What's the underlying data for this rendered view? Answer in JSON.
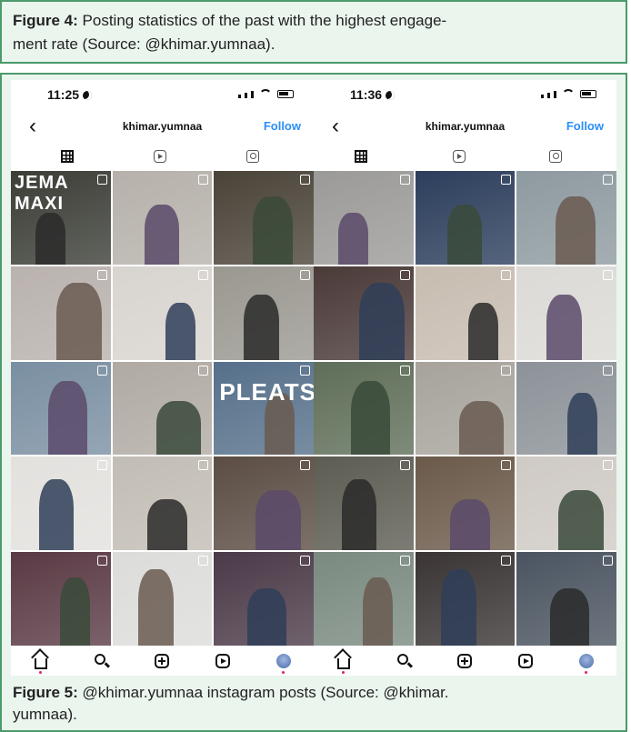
{
  "figure4": {
    "label": "Figure 4:",
    "line1": " Posting statistics of the past with the highest engage-",
    "line2": "ment rate (Source: @khimar.yumnaa)."
  },
  "figure5": {
    "label": "Figure 5:",
    "line1": " @khimar.yumnaa instagram posts (Source: @khimar.",
    "line2": "yumnaa)."
  },
  "phones": [
    {
      "time": "11:25",
      "username": "khimar.yumnaa",
      "follow_label": "Follow",
      "tiles": [
        {
          "bg": "#3b3d36",
          "label": "JEMA MAXI"
        },
        {
          "bg": "#b6b1aa"
        },
        {
          "bg": "#4a4338"
        },
        {
          "bg": "#b9b2ae"
        },
        {
          "bg": "#d8d4cf"
        },
        {
          "bg": "#9a9890"
        },
        {
          "bg": "#7a8fa2"
        },
        {
          "bg": "#b0aaa3"
        },
        {
          "bg": "#56708a",
          "label": "PLEATS"
        },
        {
          "bg": "#e3e1de"
        },
        {
          "bg": "#c2bdb4"
        },
        {
          "bg": "#5b4d44"
        },
        {
          "bg": "#5a3a44"
        },
        {
          "bg": "#dcdcda"
        },
        {
          "bg": "#4b3a48"
        }
      ]
    },
    {
      "time": "11:36",
      "username": "khimar.yumnaa",
      "follow_label": "Follow",
      "tiles": [
        {
          "bg": "#9b9a98"
        },
        {
          "bg": "#2c3e5c"
        },
        {
          "bg": "#8e9aa0"
        },
        {
          "bg": "#4a3a38"
        },
        {
          "bg": "#c7bcb0"
        },
        {
          "bg": "#dcdad6"
        },
        {
          "bg": "#5f6e58"
        },
        {
          "bg": "#a7a39c"
        },
        {
          "bg": "#8c9298"
        },
        {
          "bg": "#5d5c52"
        },
        {
          "bg": "#6b5a4a"
        },
        {
          "bg": "#cfcac4"
        },
        {
          "bg": "#7a8a80"
        },
        {
          "bg": "#3a3434"
        },
        {
          "bg": "#4a5460"
        }
      ]
    }
  ]
}
